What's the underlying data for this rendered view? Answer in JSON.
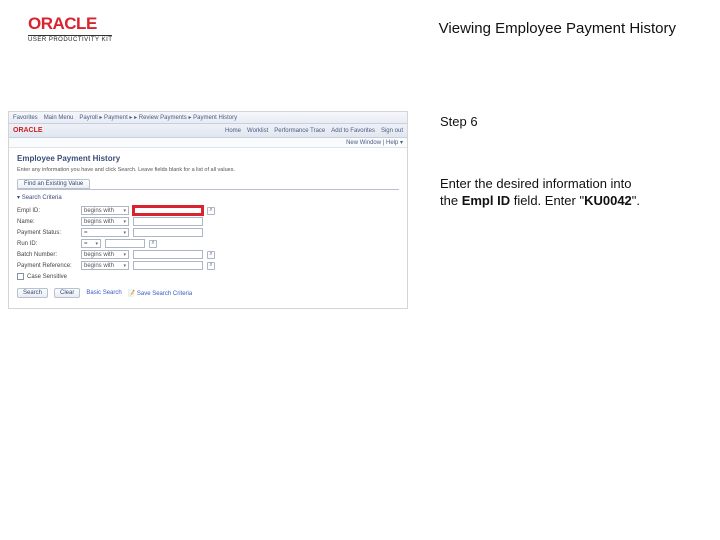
{
  "header": {
    "logo_text": "ORACLE",
    "logo_sub": "USER PRODUCTIVITY KIT",
    "title": "Viewing Employee Payment History"
  },
  "instructions": {
    "step_label": "Step 6",
    "line1": "Enter the desired information into",
    "line2_prefix": "the ",
    "line2_field": "Empl ID",
    "line2_mid": " field. Enter \"",
    "line2_value": "KU0042",
    "line2_suffix": "\"."
  },
  "screenshot": {
    "topbar": {
      "item1": "Favorites",
      "item2": "Main Menu",
      "crumb": "Payroll ▸ Payment ▸ ▸ Review Payments ▸ Payment History"
    },
    "header2": {
      "brand": "ORACLE",
      "link_home": "Home",
      "link_worklist": "Worklist",
      "link_perf": "Performance Trace",
      "link_add": "Add to Favorites",
      "link_signout": "Sign out"
    },
    "subbar": "New Window | Help ▾",
    "page_title": "Employee Payment History",
    "page_desc": "Enter any information you have and click Search. Leave fields blank for a list of all values.",
    "tab": "Find an Existing Value",
    "search_label": "Search Criteria",
    "fields": [
      {
        "label": "Empl ID:",
        "op": "begins with",
        "lookup": true,
        "highlight": true
      },
      {
        "label": "Name:",
        "op": "begins with",
        "lookup": false
      },
      {
        "label": "Payment Status:",
        "op": "=",
        "lookup": false,
        "dropdown": true
      },
      {
        "label": "Run ID:",
        "op": "=",
        "lookup": true,
        "short": true
      },
      {
        "label": "Batch Number:",
        "op": "begins with",
        "lookup": true
      },
      {
        "label": "Payment Reference:",
        "op": "begins with",
        "lookup": true
      }
    ],
    "case_sensitive": "Case Sensitive",
    "buttons": {
      "search": "Search",
      "clear": "Clear",
      "basic": "Basic Search",
      "save": "Save Search Criteria"
    }
  }
}
